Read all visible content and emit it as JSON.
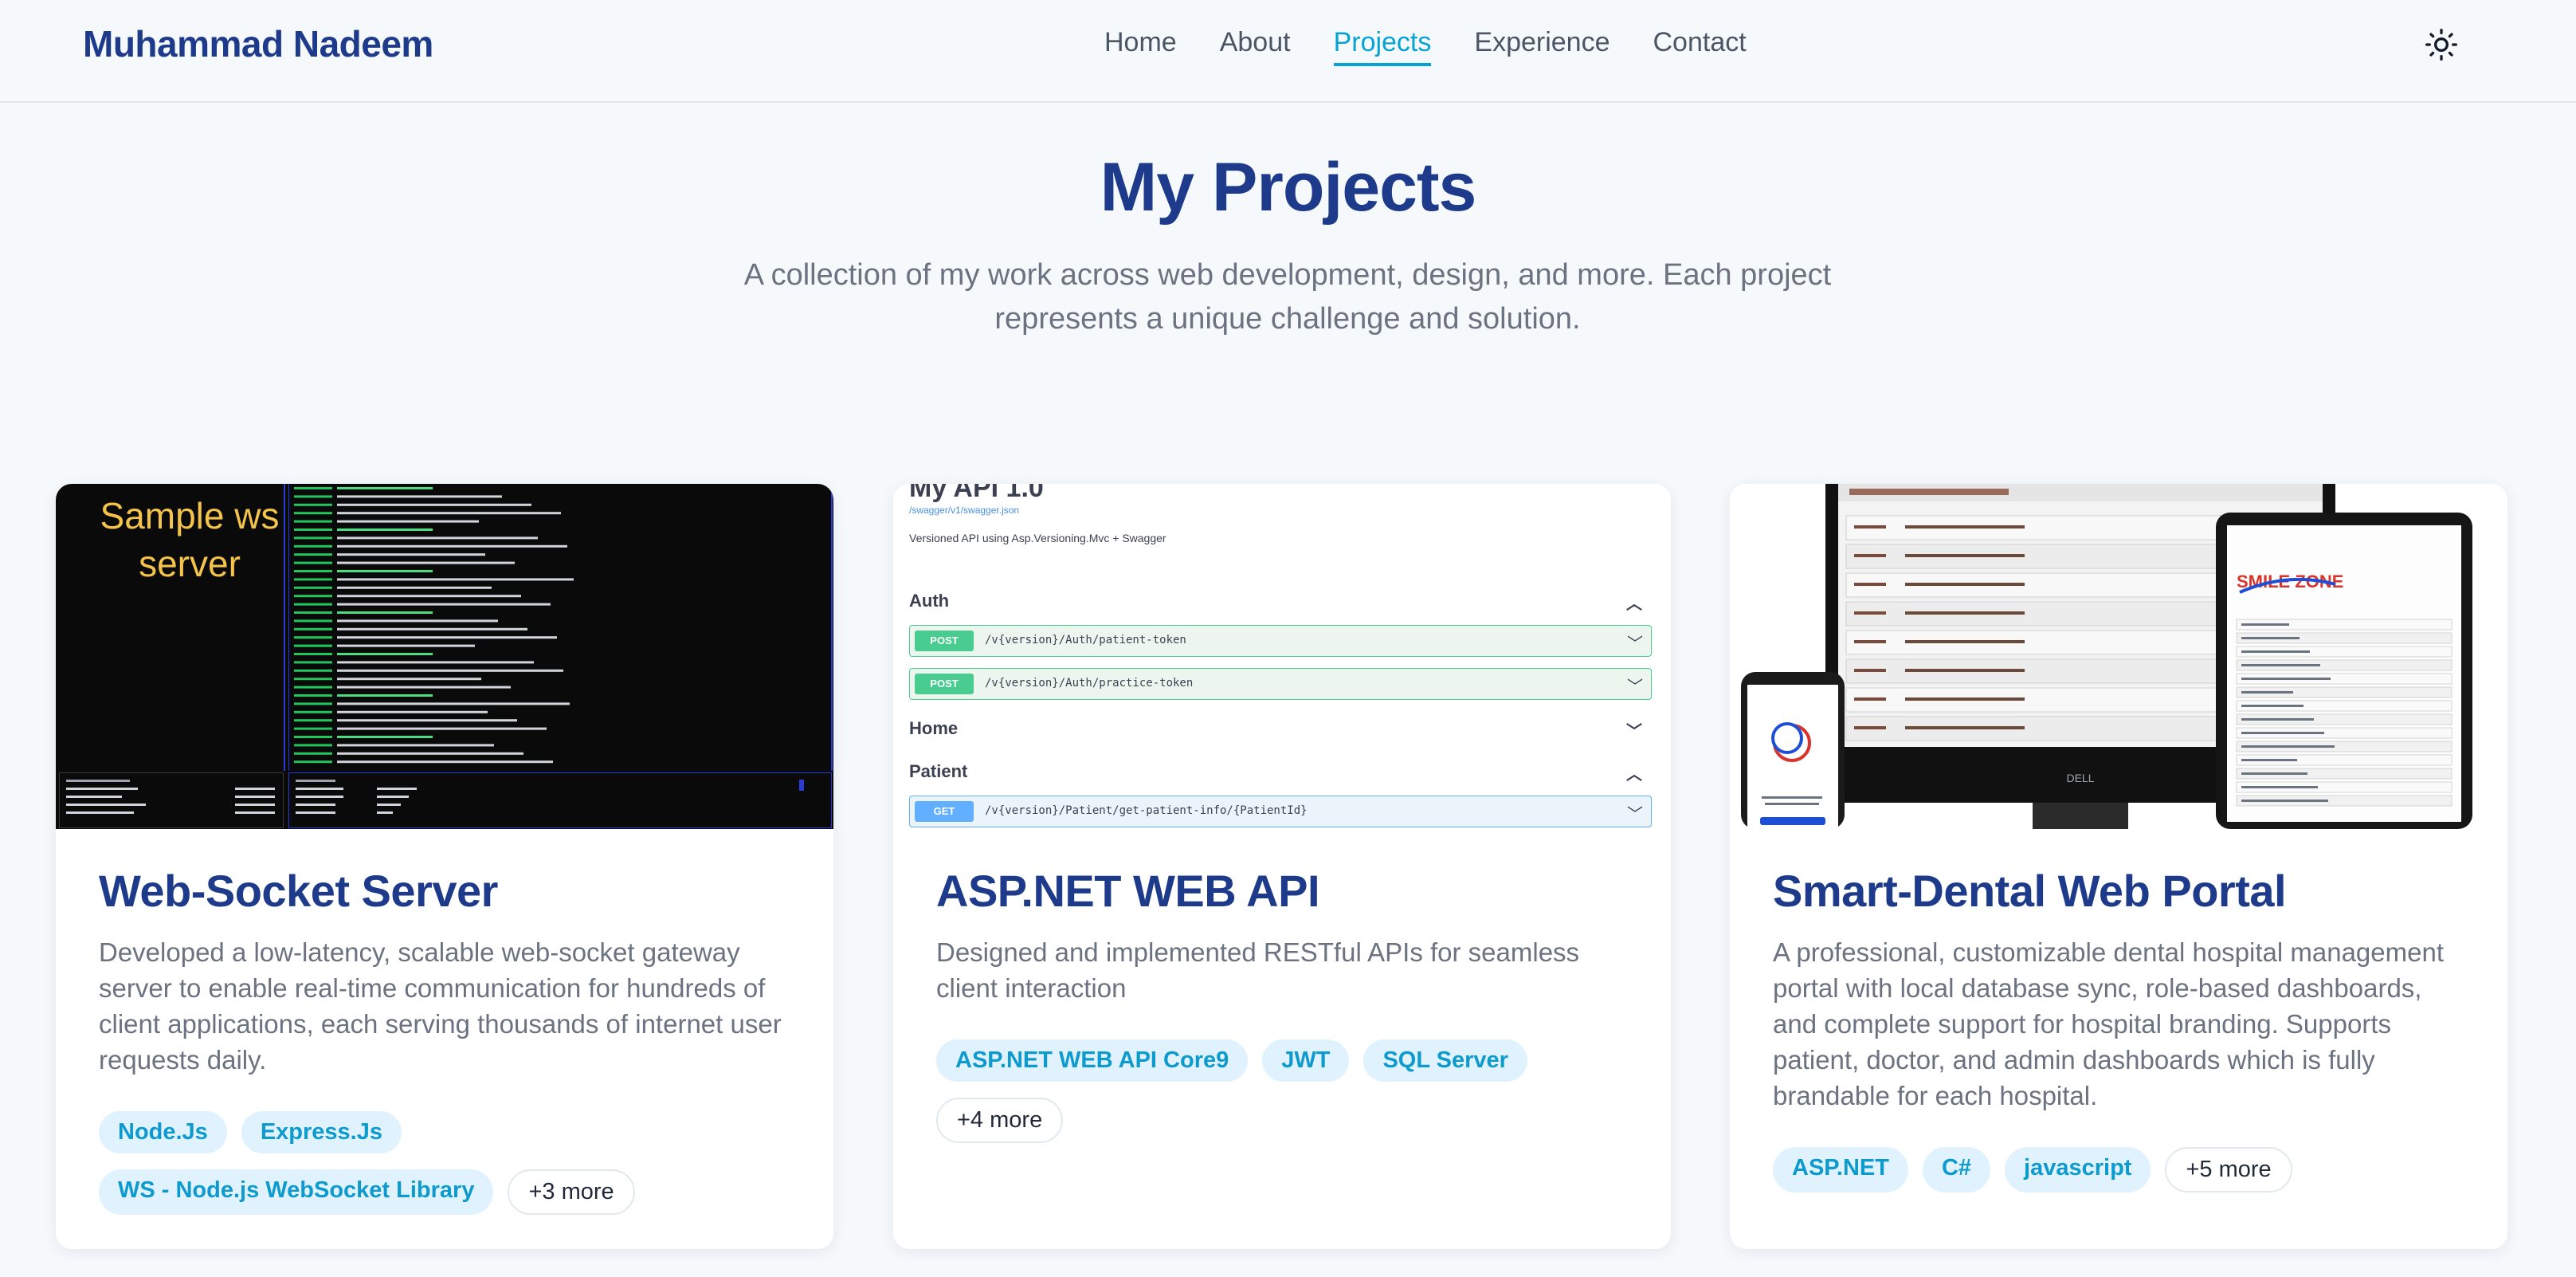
{
  "nav": {
    "brand": "Muhammad Nadeem",
    "links": [
      "Home",
      "About",
      "Projects",
      "Experience",
      "Contact"
    ],
    "active": "Projects",
    "theme_icon": "sun-icon"
  },
  "header": {
    "title": "My Projects",
    "subtitle": "A collection of my work across web development, design, and more. Each project represents a unique challenge and solution."
  },
  "projects": [
    {
      "title": "Web-Socket Server",
      "description": "Developed a low-latency, scalable web-socket gateway server to enable real-time communication for hundreds of client applications, each serving thousands of internet user requests daily.",
      "tags": [
        "Node.Js",
        "Express.Js",
        "WS - Node.js WebSocket Library"
      ],
      "more": "+3 more",
      "image": {
        "overlay_text": "Sample ws server"
      }
    },
    {
      "title": "ASP.NET WEB API",
      "description": "Designed and implemented RESTful APIs for seamless client interaction",
      "tags": [
        "ASP.NET WEB API Core9",
        "JWT",
        "SQL Server"
      ],
      "more": "+4 more",
      "image": {
        "api_title": "My API 1.0",
        "api_link": "/swagger/v1/swagger.json",
        "api_desc": "Versioned API using Asp.Versioning.Mvc + Swagger",
        "sections": [
          "Auth",
          "Home",
          "Patient"
        ],
        "ops": [
          {
            "method": "POST",
            "path": "/v{version}/Auth/patient-token"
          },
          {
            "method": "POST",
            "path": "/v{version}/Auth/practice-token"
          },
          {
            "method": "GET",
            "path": "/v{version}/Patient/get-patient-info/{PatientId}"
          }
        ]
      }
    },
    {
      "title": "Smart-Dental Web Portal",
      "description": "A professional, customizable dental hospital management portal with local database sync, role-based dashboards, and complete support for hospital branding. Supports patient, doctor, and admin dashboards which is fully brandable for each hospital.",
      "tags": [
        "ASP.NET",
        "C#",
        "javascript"
      ],
      "more": "+5 more",
      "image": {
        "brand_text": "SMILE ZONE",
        "monitor_label": "DELL"
      }
    }
  ]
}
